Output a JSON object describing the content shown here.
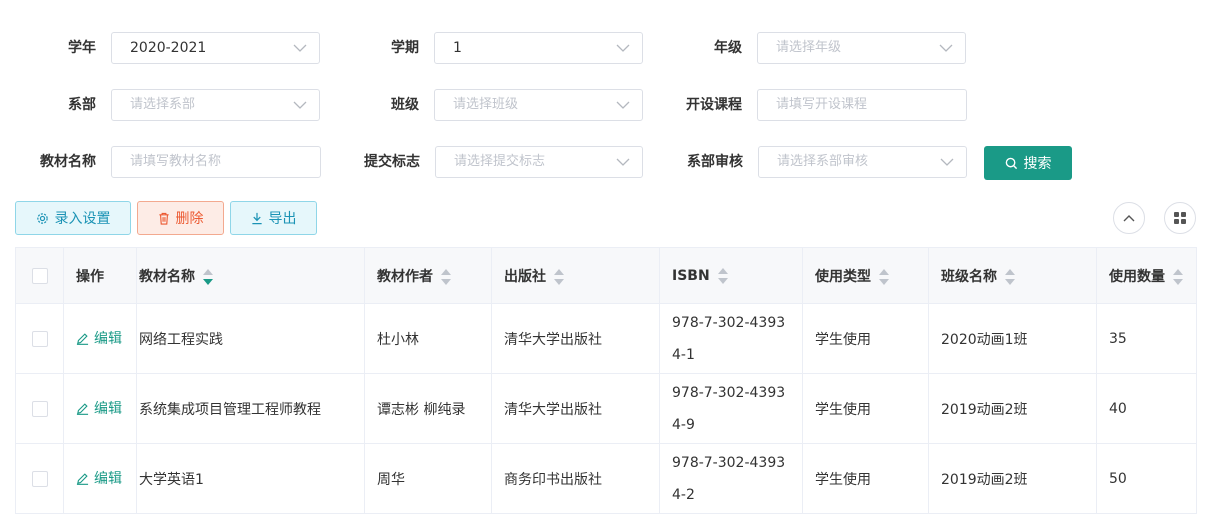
{
  "filters": {
    "year": {
      "label": "学年",
      "value": "2020-2021"
    },
    "term": {
      "label": "学期",
      "value": "1"
    },
    "grade": {
      "label": "年级",
      "placeholder": "请选择年级"
    },
    "department": {
      "label": "系部",
      "placeholder": "请选择系部"
    },
    "class": {
      "label": "班级",
      "placeholder": "请选择班级"
    },
    "course": {
      "label": "开设课程",
      "placeholder": "请填写开设课程"
    },
    "textbook_name": {
      "label": "教材名称",
      "placeholder": "请填写教材名称"
    },
    "submit_flag": {
      "label": "提交标志",
      "placeholder": "请选择提交标志"
    },
    "dept_review": {
      "label": "系部审核",
      "placeholder": "请选择系部审核"
    },
    "search_button": "搜索"
  },
  "toolbar": {
    "settings_label": "录入设置",
    "delete_label": "删除",
    "export_label": "导出"
  },
  "colors": {
    "primary": "#1a9a87",
    "info": "#1b93b5",
    "danger": "#ec5a32"
  },
  "table": {
    "columns": [
      "操作",
      "教材名称",
      "教材作者",
      "出版社",
      "ISBN",
      "使用类型",
      "班级名称",
      "使用数量"
    ],
    "edit_label": "编辑",
    "rows": [
      {
        "name": "网络工程实践",
        "author": "杜小林",
        "publisher": "清华大学出版社",
        "isbn_line1": "978-7-302-4393",
        "isbn_line2": "4-1",
        "type": "学生使用",
        "class": "2020动画1班",
        "qty": "35"
      },
      {
        "name": "系统集成项目管理工程师教程",
        "author": "谭志彬 柳纯录",
        "publisher": "清华大学出版社",
        "isbn_line1": "978-7-302-4393",
        "isbn_line2": "4-9",
        "type": "学生使用",
        "class": "2019动画2班",
        "qty": "40"
      },
      {
        "name": "大学英语1",
        "author": "周华",
        "publisher": "商务印书出版社",
        "isbn_line1": "978-7-302-4393",
        "isbn_line2": "4-2",
        "type": "学生使用",
        "class": "2019动画2班",
        "qty": "50"
      }
    ]
  }
}
